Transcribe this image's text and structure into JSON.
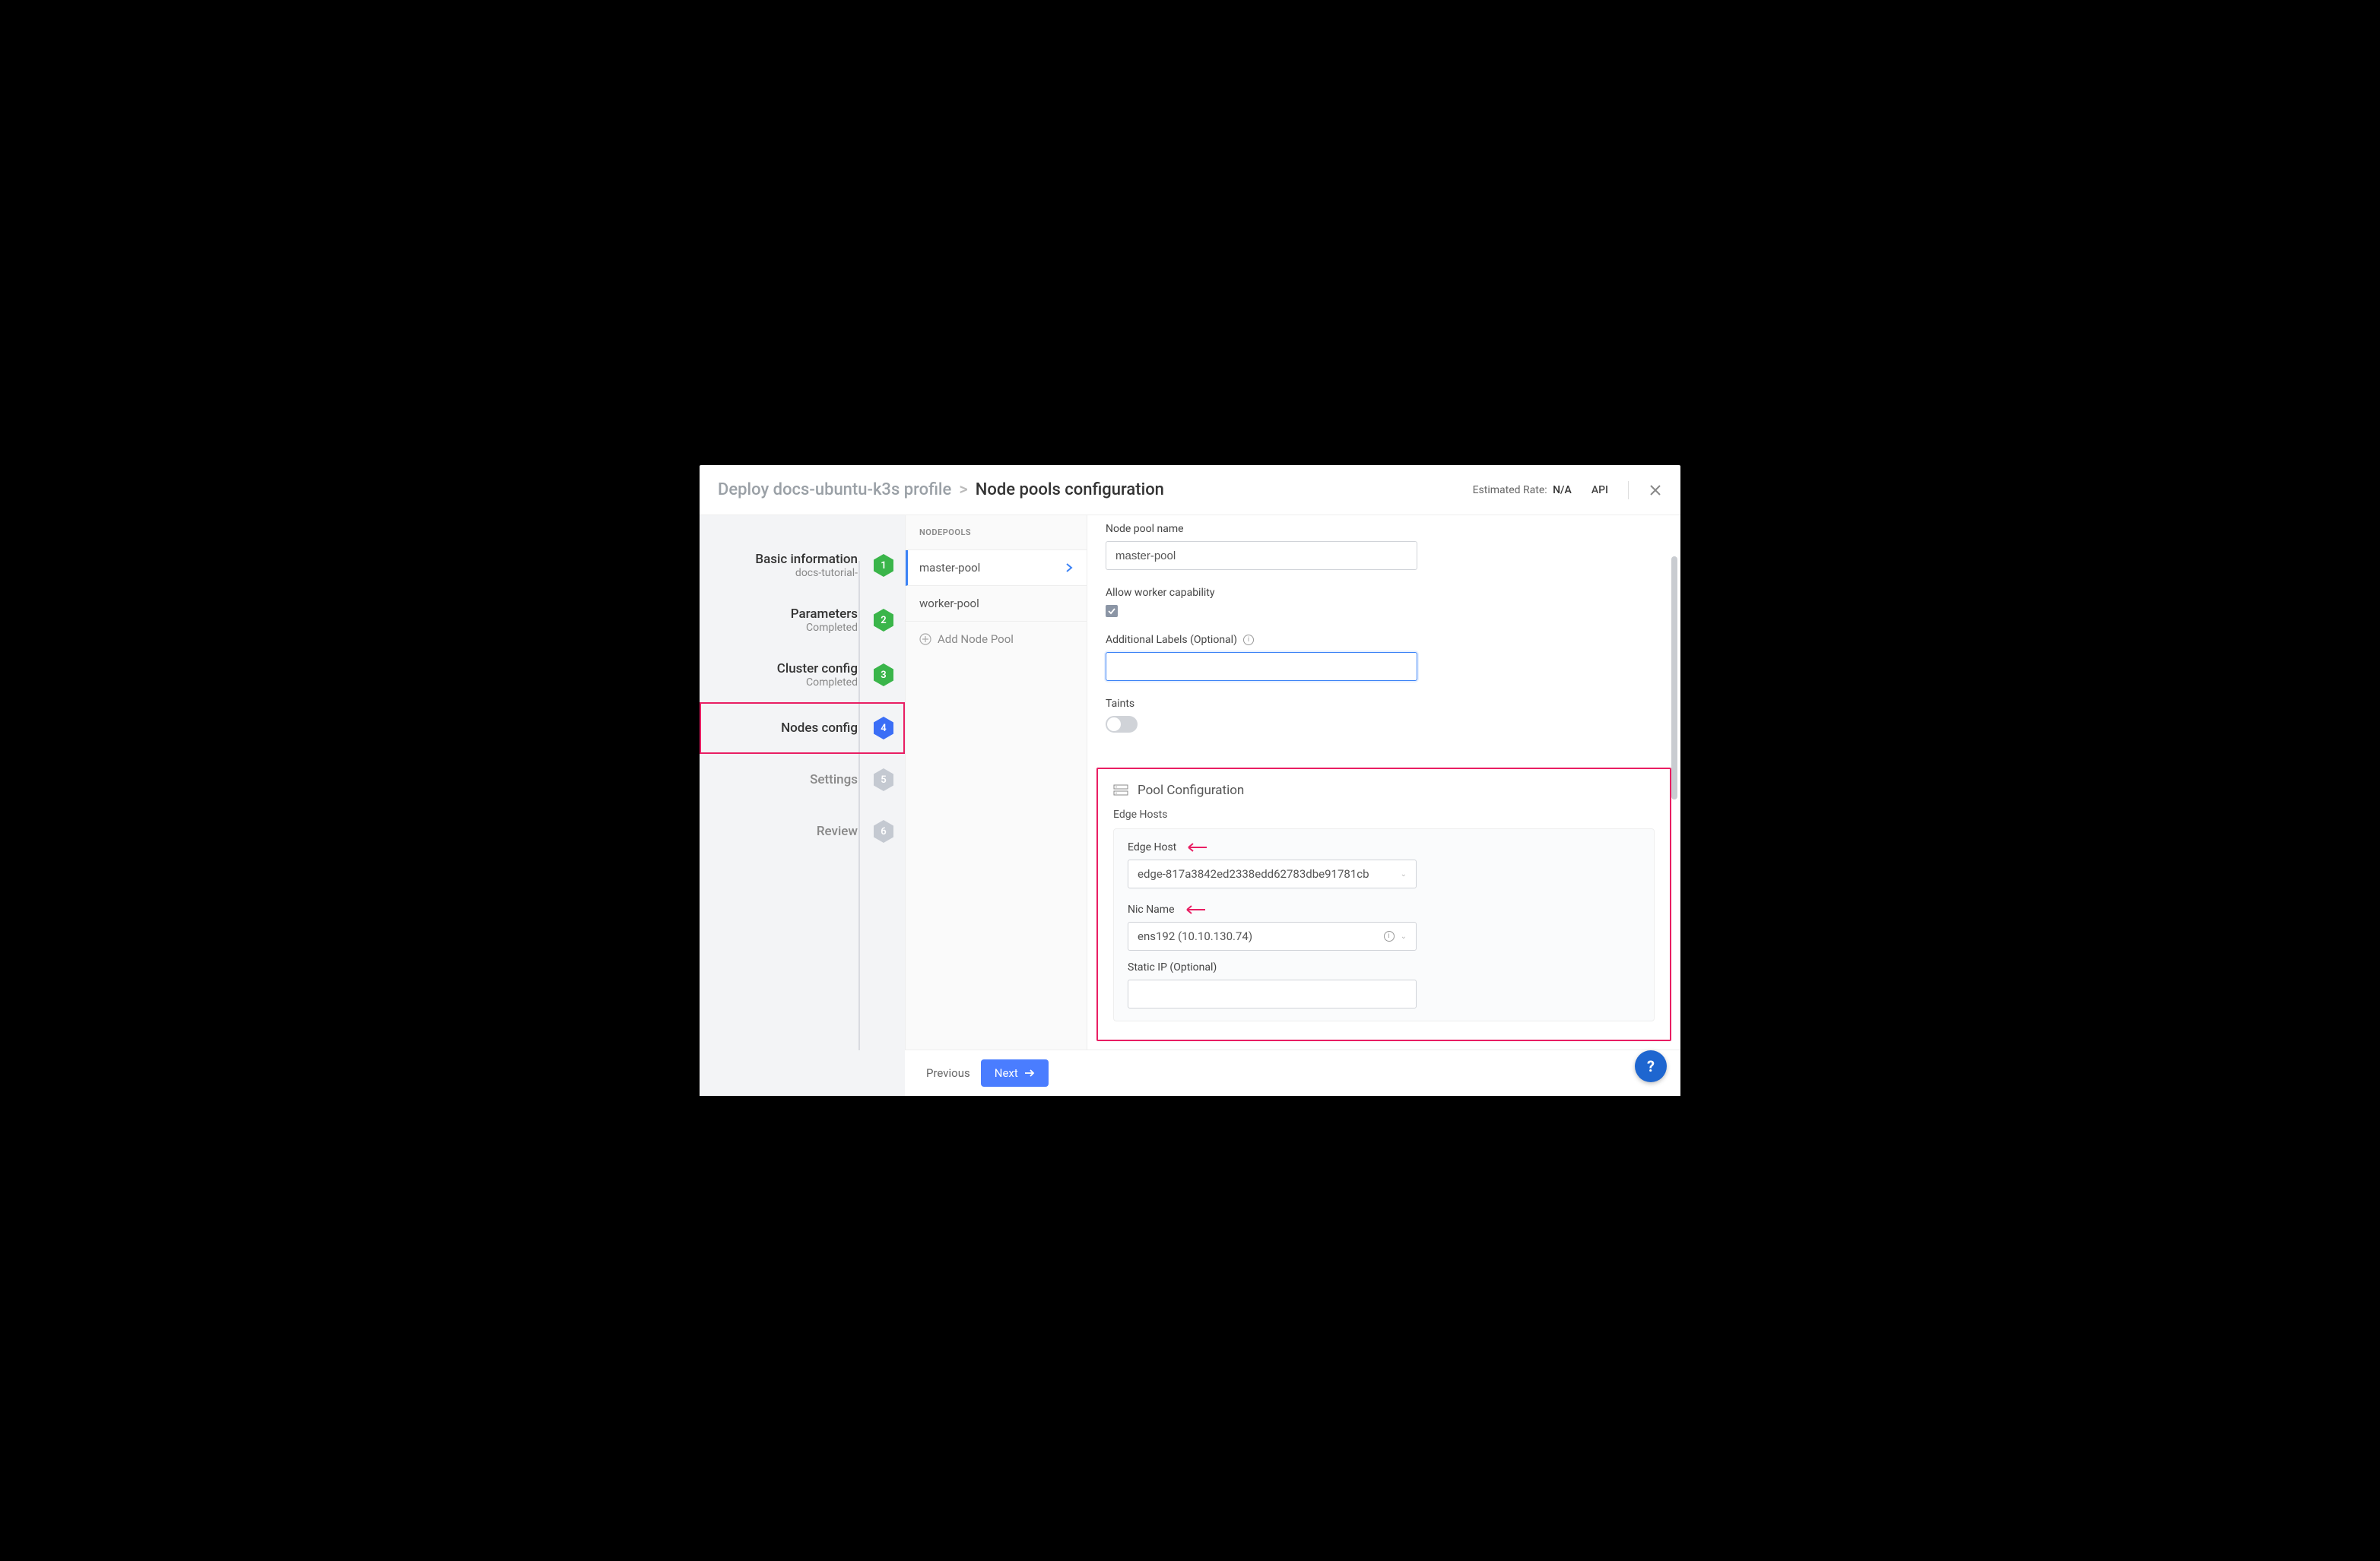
{
  "header": {
    "breadcrumb_prefix": "Deploy docs-ubuntu-k3s profile",
    "breadcrumb_sep": ">",
    "breadcrumb_current": "Node pools configuration",
    "estimated_rate_label": "Estimated Rate:",
    "estimated_rate_value": "N/A",
    "api_label": "API"
  },
  "stepper": [
    {
      "num": "1",
      "title": "Basic information",
      "sub": "docs-tutorial-",
      "color": "#3ab54a"
    },
    {
      "num": "2",
      "title": "Parameters",
      "sub": "Completed",
      "color": "#3ab54a"
    },
    {
      "num": "3",
      "title": "Cluster config",
      "sub": "Completed",
      "color": "#3ab54a"
    },
    {
      "num": "4",
      "title": "Nodes config",
      "sub": "",
      "color": "#3b6ef6",
      "highlighted": true
    },
    {
      "num": "5",
      "title": "Settings",
      "sub": "",
      "color": "#c4c9d1",
      "pending": true
    },
    {
      "num": "6",
      "title": "Review",
      "sub": "",
      "color": "#c4c9d1",
      "pending": true
    }
  ],
  "nodepools": {
    "header": "NODEPOOLS",
    "items": [
      {
        "label": "master-pool",
        "active": true
      },
      {
        "label": "worker-pool",
        "active": false
      }
    ],
    "add_label": "Add Node Pool"
  },
  "form": {
    "pool_name_label": "Node pool name",
    "pool_name_value": "master-pool",
    "allow_worker_label": "Allow worker capability",
    "labels_label": "Additional Labels (Optional)",
    "taints_label": "Taints",
    "pool_config_title": "Pool Configuration",
    "edge_hosts_label": "Edge Hosts",
    "edge_host_label": "Edge Host",
    "edge_host_value": "edge-817a3842ed2338edd62783dbe91781cb",
    "nic_name_label": "Nic Name",
    "nic_name_value": "ens192 (10.10.130.74)",
    "static_ip_label": "Static IP (Optional)",
    "static_ip_value": ""
  },
  "footer": {
    "prev": "Previous",
    "next": "Next"
  },
  "help": "?"
}
